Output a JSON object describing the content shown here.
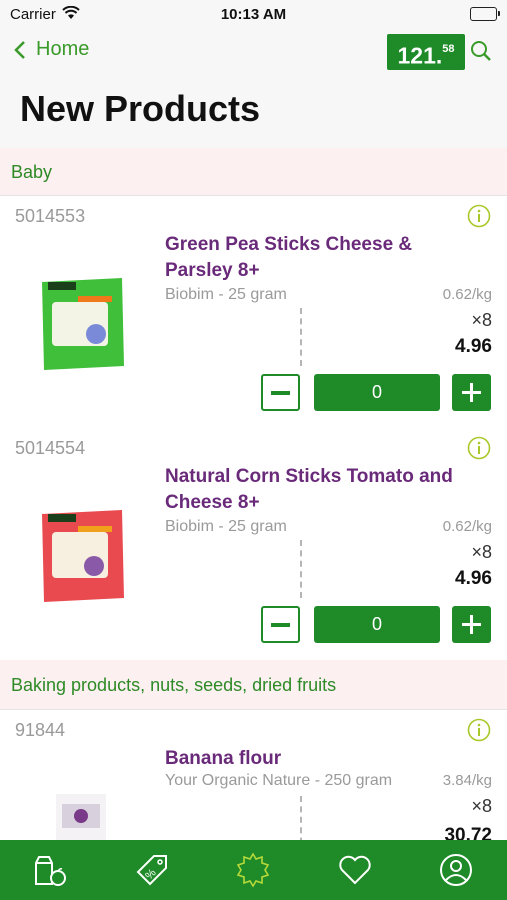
{
  "status_bar": {
    "carrier": "Carrier",
    "time": "10:13 AM"
  },
  "header": {
    "back_label": "Home",
    "cart_total_main": "121.",
    "cart_total_cents": "58",
    "title": "New Products"
  },
  "categories": [
    {
      "name": "Baby",
      "products": [
        {
          "sku": "5014553",
          "name": "Green Pea Sticks Cheese & Parsley 8+",
          "brand": "Biobim - 25 gram",
          "unit_price": "0.62/kg",
          "multiplier": "×8",
          "price": "4.96",
          "quantity": "0",
          "pack_color": "#3fbf3a"
        },
        {
          "sku": "5014554",
          "name": "Natural Corn Sticks Tomato and Cheese 8+",
          "brand": "Biobim - 25 gram",
          "unit_price": "0.62/kg",
          "multiplier": "×8",
          "price": "4.96",
          "quantity": "0",
          "pack_color": "#e84a4f"
        }
      ]
    },
    {
      "name": "Baking products, nuts, seeds, dried fruits",
      "products": [
        {
          "sku": "91844",
          "name": "Banana flour",
          "brand": "Your Organic Nature - 250 gram",
          "unit_price": "3.84/kg",
          "multiplier": "×8",
          "price": "30.72"
        }
      ]
    }
  ],
  "tabbar": [
    "grocery-icon",
    "discount-tag-icon",
    "new-badge-icon",
    "heart-icon",
    "account-icon"
  ],
  "colors": {
    "brand_green": "#1e8a28",
    "link_green": "#3a9a2a",
    "product_purple": "#6a2a7a",
    "category_bg": "#fcf0f0"
  }
}
